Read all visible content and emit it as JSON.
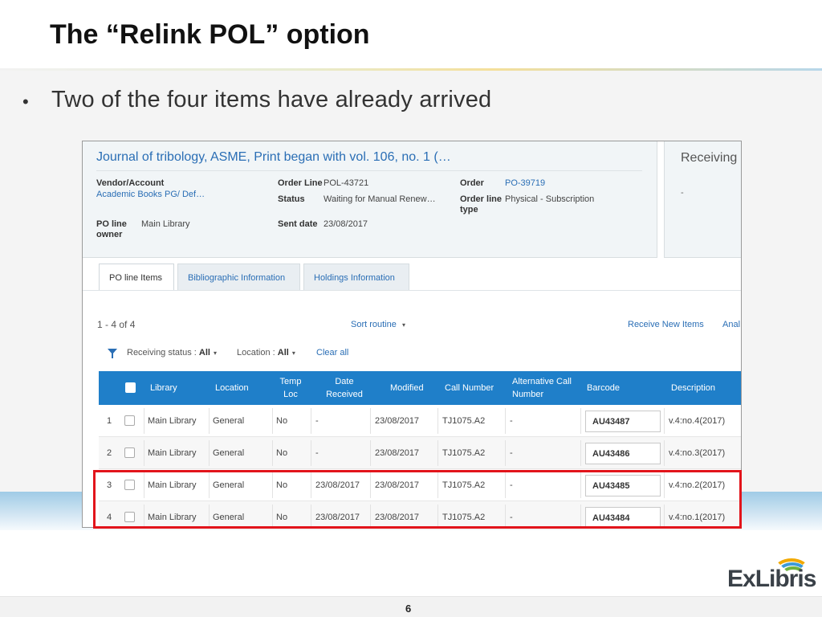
{
  "slide": {
    "title": "The “Relink POL” option",
    "bullet": "Two of the four items have already arrived",
    "page_number": "6",
    "logo_text": "ExLibris"
  },
  "header": {
    "title": "Journal of tribology, ASME, Print began with vol. 106, no. 1 (…",
    "vendor_label": "Vendor/Account",
    "vendor_value": "Academic Books PG/ Def…",
    "po_owner_label_1": "PO line",
    "po_owner_label_2": "owner",
    "po_owner_value": "Main Library",
    "order_line_label": "Order Line",
    "order_line_value": "POL-43721",
    "status_label": "Status",
    "status_value": "Waiting for Manual Renew…",
    "sent_date_label": "Sent date",
    "sent_date_value": "23/08/2017",
    "order_label": "Order",
    "order_value": "PO-39719",
    "order_line_type_label_1": "Order line",
    "order_line_type_label_2": "type",
    "order_line_type_value": "Physical - Subscription"
  },
  "side_panel": {
    "title": "Receiving n",
    "value": "-"
  },
  "tabs": [
    {
      "label": "PO line Items",
      "active": true
    },
    {
      "label": "Bibliographic Information",
      "active": false
    },
    {
      "label": "Holdings Information",
      "active": false
    }
  ],
  "toolbar": {
    "count": "1 - 4 of 4",
    "sort": "Sort routine",
    "receive_new": "Receive New Items",
    "more": "Anal"
  },
  "filters": {
    "receiving_label": "Receiving status :",
    "receiving_value": "All",
    "location_label": "Location :",
    "location_value": "All",
    "clear_all": "Clear all"
  },
  "table": {
    "columns": {
      "library": "Library",
      "location": "Location",
      "temp_loc_1": "Temp",
      "temp_loc_2": "Loc",
      "date_received_1": "Date",
      "date_received_2": "Received",
      "modified": "Modified",
      "call_number": "Call Number",
      "alt_call_1": "Alternative Call",
      "alt_call_2": "Number",
      "barcode": "Barcode",
      "description": "Description"
    },
    "rows": [
      {
        "num": "1",
        "library": "Main Library",
        "location": "General",
        "temp_loc": "No",
        "date_received": "-",
        "modified": "23/08/2017",
        "call_number": "TJ1075.A2",
        "alt_call": "-",
        "barcode": "AU43487",
        "description": "v.4:no.4(2017)"
      },
      {
        "num": "2",
        "library": "Main Library",
        "location": "General",
        "temp_loc": "No",
        "date_received": "-",
        "modified": "23/08/2017",
        "call_number": "TJ1075.A2",
        "alt_call": "-",
        "barcode": "AU43486",
        "description": "v.4:no.3(2017)"
      },
      {
        "num": "3",
        "library": "Main Library",
        "location": "General",
        "temp_loc": "No",
        "date_received": "23/08/2017",
        "modified": "23/08/2017",
        "call_number": "TJ1075.A2",
        "alt_call": "-",
        "barcode": "AU43485",
        "description": "v.4:no.2(2017)"
      },
      {
        "num": "4",
        "library": "Main Library",
        "location": "General",
        "temp_loc": "No",
        "date_received": "23/08/2017",
        "modified": "23/08/2017",
        "call_number": "TJ1075.A2",
        "alt_call": "-",
        "barcode": "AU43484",
        "description": "v.4:no.1(2017)"
      }
    ]
  },
  "colors": {
    "accent_blue": "#1f7fc9",
    "link_blue": "#2a6eb5",
    "highlight_red": "#e2141b"
  }
}
